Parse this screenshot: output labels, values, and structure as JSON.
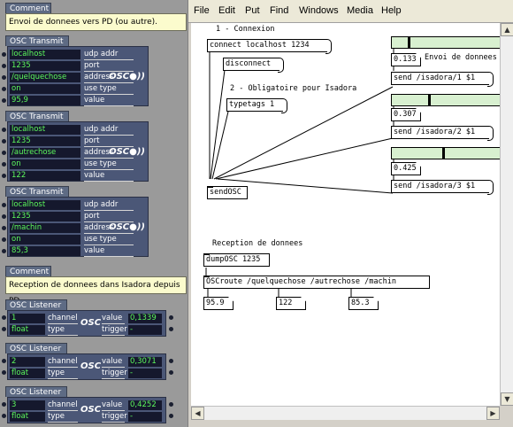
{
  "isadora": {
    "comment1": {
      "title": "Comment",
      "text": "Envoi de donnees vers PD (ou autre)."
    },
    "transmits": [
      {
        "title": "OSC Transmit",
        "rows": [
          {
            "value": "localhost",
            "label": "udp addr"
          },
          {
            "value": "1235",
            "label": "port"
          },
          {
            "value": "/quelquechose",
            "label": "address"
          },
          {
            "value": "on",
            "label": "use type"
          },
          {
            "value": "95,9",
            "label": "value"
          }
        ]
      },
      {
        "title": "OSC Transmit",
        "rows": [
          {
            "value": "localhost",
            "label": "udp addr"
          },
          {
            "value": "1235",
            "label": "port"
          },
          {
            "value": "/autrechose",
            "label": "address"
          },
          {
            "value": "on",
            "label": "use type"
          },
          {
            "value": "122",
            "label": "value"
          }
        ]
      },
      {
        "title": "OSC Transmit",
        "rows": [
          {
            "value": "localhost",
            "label": "udp addr"
          },
          {
            "value": "1235",
            "label": "port"
          },
          {
            "value": "/machin",
            "label": "address"
          },
          {
            "value": "on",
            "label": "use type"
          },
          {
            "value": "85,3",
            "label": "value"
          }
        ]
      }
    ],
    "osc_logo": "OSC",
    "comment2": {
      "title": "Comment",
      "text": "Reception de donnees dans Isadora depuis PD"
    },
    "listeners": [
      {
        "title": "OSC Listener",
        "channel": "1",
        "type": "float",
        "channel_label": "channel",
        "type_label": "type",
        "value_label": "value",
        "trigger_label": "trigger",
        "value": "0,1339",
        "trigger": "-"
      },
      {
        "title": "OSC Listener",
        "channel": "2",
        "type": "float",
        "channel_label": "channel",
        "type_label": "type",
        "value_label": "value",
        "trigger_label": "trigger",
        "value": "0,3071",
        "trigger": "-"
      },
      {
        "title": "OSC Listener",
        "channel": "3",
        "type": "float",
        "channel_label": "channel",
        "type_label": "type",
        "value_label": "value",
        "trigger_label": "trigger",
        "value": "0,4252",
        "trigger": "-"
      }
    ]
  },
  "pd": {
    "menu": [
      "File",
      "Edit",
      "Put",
      "Find",
      "Windows",
      "Media",
      "Help"
    ],
    "comments": {
      "connexion": "1 - Connexion",
      "obligatoire": "2 - Obligatoire pour Isadora",
      "envoi": "Envoi de donnees",
      "reception": "Reception de donnees"
    },
    "messages": {
      "connect": "connect localhost 1234",
      "disconnect": "disconnect",
      "typetags": "typetags 1",
      "send1": "send /isadora/1 $1",
      "send2": "send /isadora/2 $1",
      "send3": "send /isadora/3 $1"
    },
    "objects": {
      "sendosc": "sendOSC",
      "dumposc": "dumpOSC 1235",
      "oscroute": "OSCroute /quelquechose /autrechose /machin"
    },
    "numbers": {
      "slider1_val": "0.133",
      "slider2_val": "0.307",
      "slider3_val": "0.425",
      "out1": "95.9",
      "out2": "122",
      "out3": "85.3"
    },
    "sliders": [
      0.133,
      0.307,
      0.425
    ]
  }
}
